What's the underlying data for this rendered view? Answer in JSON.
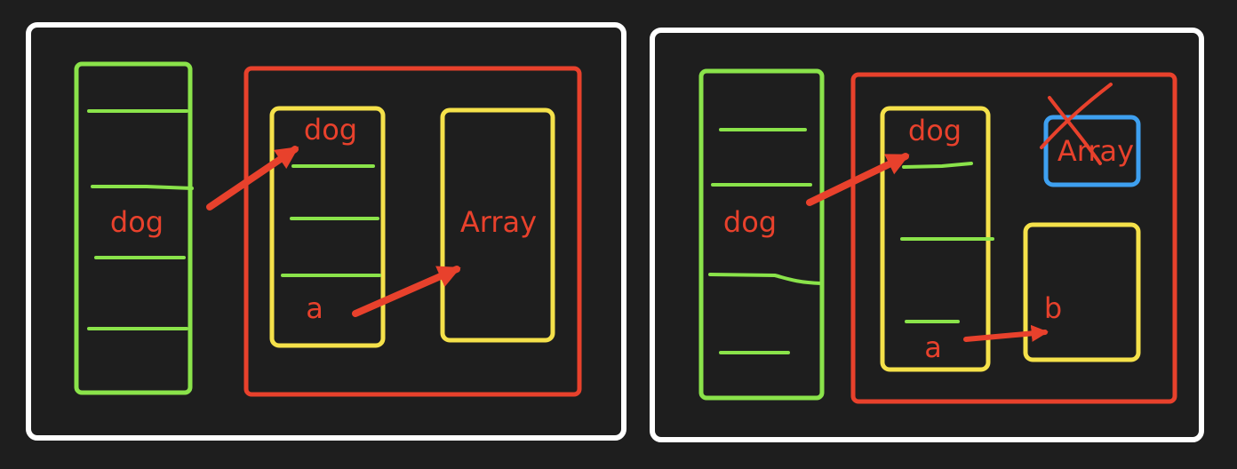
{
  "colors": {
    "background": "#1e1e1e",
    "frame": "#ffffff",
    "stack": "#8ae34a",
    "heap": "#e8412c",
    "object": "#f5e14a",
    "highlight": "#3ea0f0",
    "label": "#e8412c"
  },
  "panels": [
    {
      "stack_label": "dog",
      "object_label": "dog",
      "variable_label": "a",
      "target_label": "Array"
    },
    {
      "stack_label": "dog",
      "object_label": "dog",
      "variable_label": "a",
      "crossed_label": "Array",
      "target_label": "b"
    }
  ]
}
